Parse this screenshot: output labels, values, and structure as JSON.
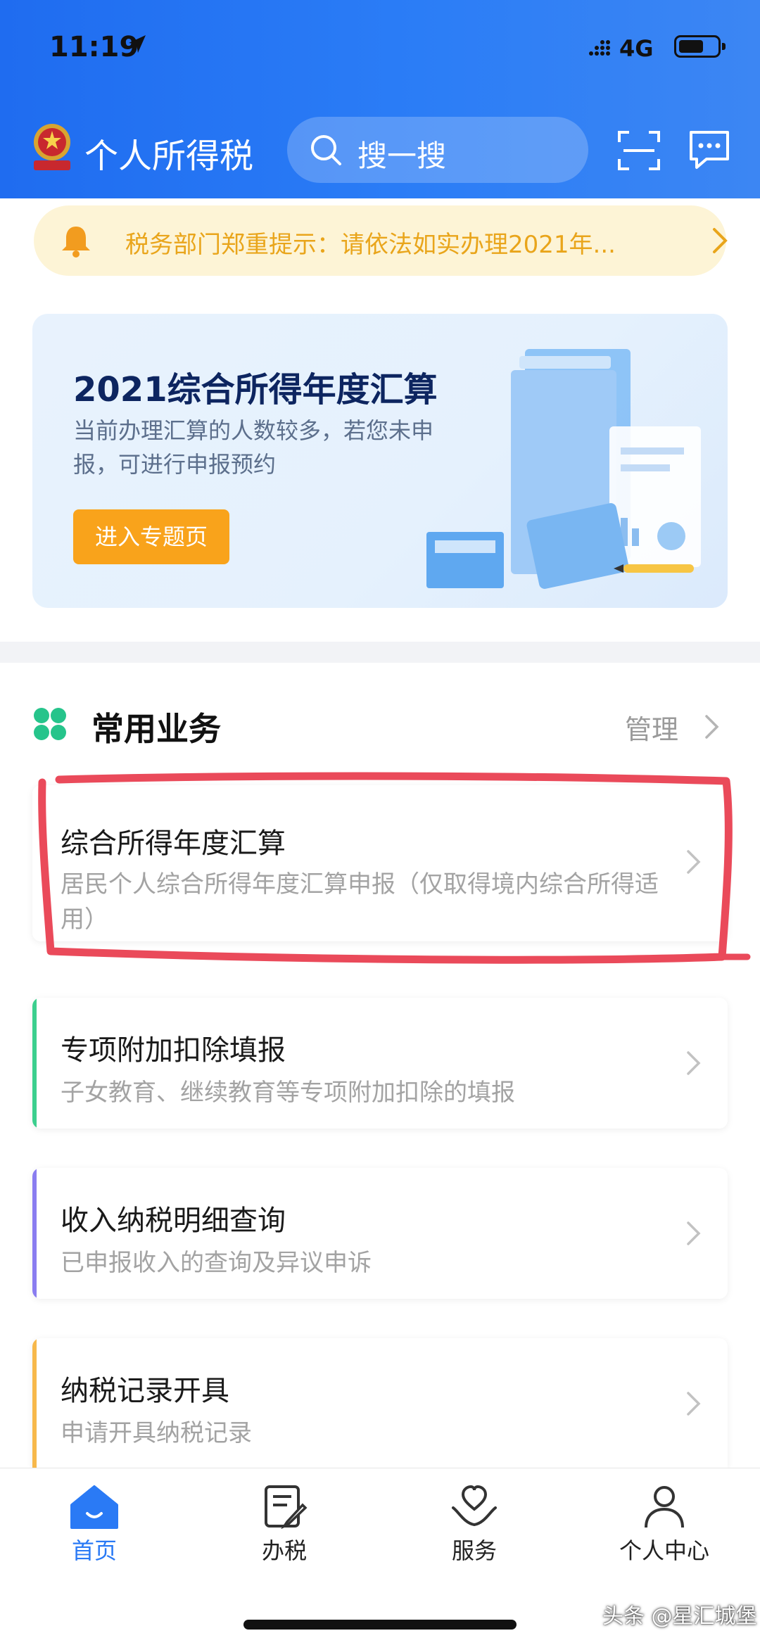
{
  "status_bar": {
    "time": "11:19",
    "network": "4G"
  },
  "header": {
    "app_title": "个人所得税",
    "search_placeholder": "搜一搜"
  },
  "notice": {
    "text": "税务部门郑重提示：请依法如实办理2021年..."
  },
  "banner": {
    "title": "2021综合所得年度汇算",
    "subtitle": "当前办理汇算的人数较多，若您未申报，可进行申报预约",
    "cta_label": "进入专题页"
  },
  "section": {
    "title": "常用业务",
    "manage_label": "管理"
  },
  "services": [
    {
      "title": "综合所得年度汇算",
      "subtitle": "居民个人综合所得年度汇算申报（仅取得境内综合所得适用）",
      "accent": "#e85d5d"
    },
    {
      "title": "专项附加扣除填报",
      "subtitle": "子女教育、继续教育等专项附加扣除的填报",
      "accent": "#3ccf8e"
    },
    {
      "title": "收入纳税明细查询",
      "subtitle": "已申报收入的查询及异议申诉",
      "accent": "#8a7df0"
    },
    {
      "title": "纳税记录开具",
      "subtitle": "申请开具纳税记录",
      "accent": "#f7b84b"
    }
  ],
  "tabbar": {
    "items": [
      {
        "label": "首页",
        "icon": "home-icon",
        "active": true
      },
      {
        "label": "办税",
        "icon": "tax-doc-icon",
        "active": false
      },
      {
        "label": "服务",
        "icon": "service-heart-icon",
        "active": false
      },
      {
        "label": "个人中心",
        "icon": "person-icon",
        "active": false
      }
    ]
  },
  "watermark": "头条 @星汇城堡",
  "colors": {
    "primary": "#2a7af5",
    "notice_text": "#e9a51b",
    "cta": "#f9a31b",
    "highlight_mark": "#ea4a5a"
  }
}
